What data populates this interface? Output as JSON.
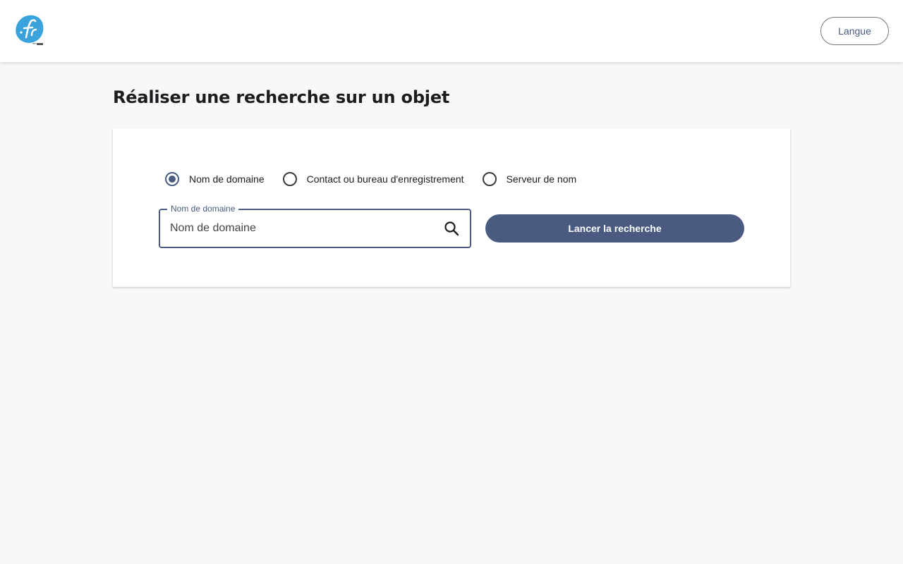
{
  "header": {
    "logo_icon": "afnic-fr-logo",
    "language_button": "Langue"
  },
  "page": {
    "title": "Réaliser une recherche sur un objet"
  },
  "search": {
    "options": [
      {
        "label": "Nom de domaine",
        "checked": true
      },
      {
        "label": "Contact ou bureau d'enregistrement",
        "checked": false
      },
      {
        "label": "Serveur de nom",
        "checked": false
      }
    ],
    "field_label": "Nom de domaine",
    "placeholder": "Nom de domaine",
    "value": "",
    "search_icon": "search-icon",
    "submit_label": "Lancer la recherche"
  },
  "colors": {
    "primary": "#4a5a80",
    "logo_blue": "#3aa3dc",
    "background": "#f9f7fa"
  }
}
